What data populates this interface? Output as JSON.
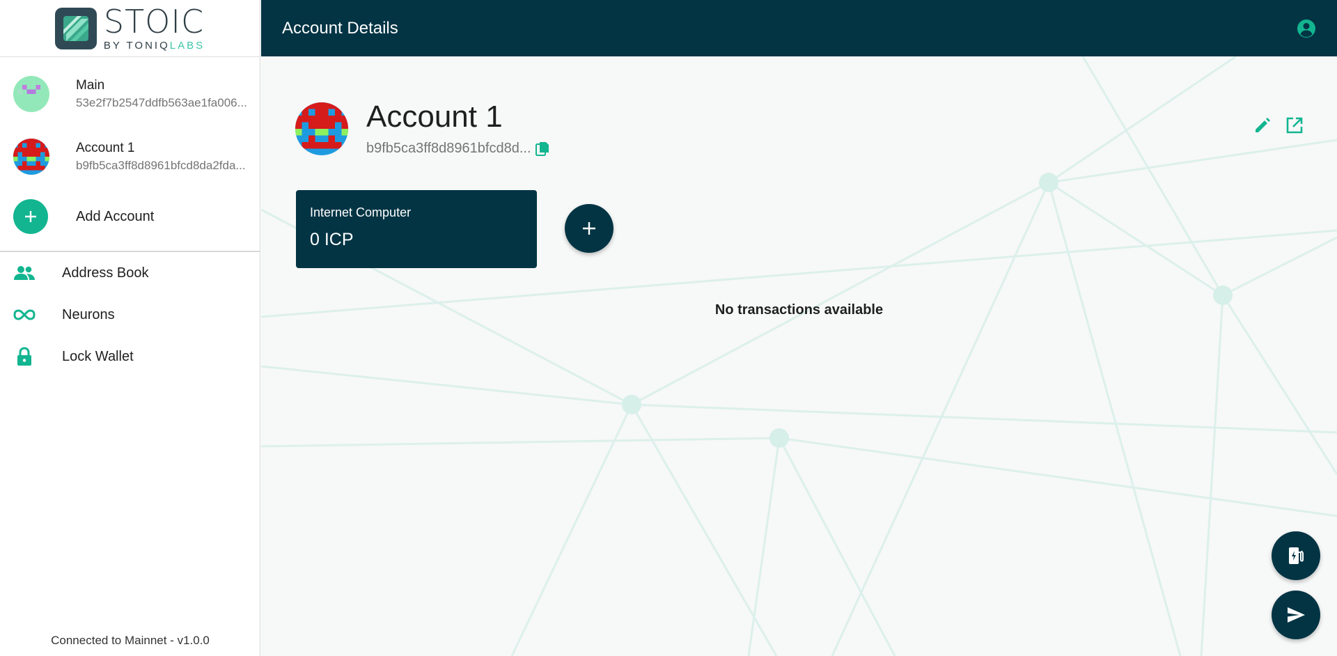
{
  "colors": {
    "header_bg": "#023444",
    "accent_green": "#12b590",
    "sidebar_bg": "#ffffff",
    "main_bg": "#f7f8f8"
  },
  "logo": {
    "word": "STOIC",
    "by": "BY TONIQ",
    "labs": "LABS"
  },
  "header": {
    "title": "Account Details",
    "profile_icon": "account-circle-icon"
  },
  "sidebar": {
    "accounts": [
      {
        "name": "Main",
        "address": "53e2f7b2547ddfb563ae1fa006...",
        "avatar": "green-pixel-avatar"
      },
      {
        "name": "Account 1",
        "address": "b9fb5ca3ff8d8961bfcd8da2fda...",
        "avatar": "red-blue-pixel-avatar"
      }
    ],
    "add_account_label": "Add Account",
    "nav": [
      {
        "label": "Address Book",
        "icon": "people-icon"
      },
      {
        "label": "Neurons",
        "icon": "infinity-icon"
      },
      {
        "label": "Lock Wallet",
        "icon": "lock-icon"
      }
    ],
    "footer": "Connected to Mainnet - v1.0.0"
  },
  "main": {
    "account_name": "Account 1",
    "account_address": "b9fb5ca3ff8d8961bfcd8d...",
    "token": {
      "name": "Internet Computer",
      "balance": "0 ICP"
    },
    "empty_message": "No transactions available"
  }
}
